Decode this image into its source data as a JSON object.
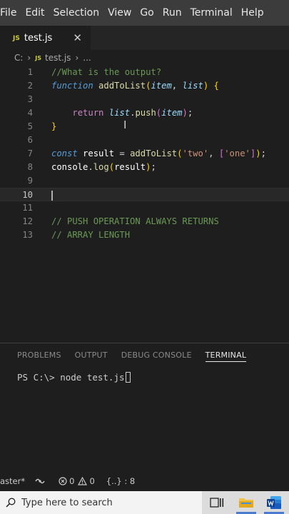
{
  "menubar": {
    "items": [
      "File",
      "Edit",
      "Selection",
      "View",
      "Go",
      "Run",
      "Terminal",
      "Help"
    ]
  },
  "tab": {
    "badge": "JS",
    "label": "test.js",
    "close": "✕"
  },
  "breadcrumb": {
    "root": "C:",
    "badge": "JS",
    "file": "test.js",
    "trail": "..."
  },
  "editor": {
    "line_numbers": [
      "1",
      "2",
      "3",
      "4",
      "5",
      "6",
      "7",
      "8",
      "9",
      "10",
      "11",
      "12",
      "13"
    ],
    "current_line": "10",
    "lines": [
      {
        "tokens": [
          {
            "t": "//What is the output?",
            "c": "c-comment"
          }
        ]
      },
      {
        "tokens": [
          {
            "t": "function",
            "c": "c-kw"
          },
          {
            "t": " ",
            "c": "c-punc"
          },
          {
            "t": "addToList",
            "c": "c-fn"
          },
          {
            "t": "(",
            "c": "c-bracket"
          },
          {
            "t": "item",
            "c": "c-param"
          },
          {
            "t": ", ",
            "c": "c-punc"
          },
          {
            "t": "list",
            "c": "c-param"
          },
          {
            "t": ")",
            "c": "c-bracket"
          },
          {
            "t": " ",
            "c": "c-punc"
          },
          {
            "t": "{",
            "c": "c-bracket"
          }
        ]
      },
      {
        "tokens": []
      },
      {
        "tokens": [
          {
            "t": "    ",
            "c": "c-punc"
          },
          {
            "t": "return",
            "c": "c-ret"
          },
          {
            "t": " ",
            "c": "c-punc"
          },
          {
            "t": "list",
            "c": "c-param"
          },
          {
            "t": ".",
            "c": "c-punc"
          },
          {
            "t": "push",
            "c": "c-fn"
          },
          {
            "t": "(",
            "c": "c-bracket2"
          },
          {
            "t": "item",
            "c": "c-param"
          },
          {
            "t": ")",
            "c": "c-bracket2"
          },
          {
            "t": ";",
            "c": "c-punc"
          }
        ]
      },
      {
        "tokens": [
          {
            "t": "}",
            "c": "c-bracket"
          }
        ]
      },
      {
        "tokens": []
      },
      {
        "tokens": [
          {
            "t": "const",
            "c": "c-kw"
          },
          {
            "t": " ",
            "c": "c-punc"
          },
          {
            "t": "result",
            "c": "c-var"
          },
          {
            "t": " = ",
            "c": "c-punc"
          },
          {
            "t": "addToList",
            "c": "c-fn"
          },
          {
            "t": "(",
            "c": "c-bracket"
          },
          {
            "t": "'two'",
            "c": "c-str"
          },
          {
            "t": ", ",
            "c": "c-punc"
          },
          {
            "t": "[",
            "c": "c-bracket2"
          },
          {
            "t": "'one'",
            "c": "c-str"
          },
          {
            "t": "]",
            "c": "c-bracket2"
          },
          {
            "t": ")",
            "c": "c-bracket"
          },
          {
            "t": ";",
            "c": "c-punc"
          }
        ]
      },
      {
        "tokens": [
          {
            "t": "console",
            "c": "c-var"
          },
          {
            "t": ".",
            "c": "c-punc"
          },
          {
            "t": "log",
            "c": "c-fn"
          },
          {
            "t": "(",
            "c": "c-bracket"
          },
          {
            "t": "result",
            "c": "c-var"
          },
          {
            "t": ")",
            "c": "c-bracket"
          },
          {
            "t": ";",
            "c": "c-punc"
          }
        ]
      },
      {
        "tokens": []
      },
      {
        "tokens": []
      },
      {
        "tokens": []
      },
      {
        "tokens": [
          {
            "t": "// PUSH OPERATION ALWAYS RETURNS",
            "c": "c-comment"
          }
        ]
      },
      {
        "tokens": [
          {
            "t": "// ARRAY LENGTH",
            "c": "c-comment"
          }
        ]
      }
    ]
  },
  "panel": {
    "tabs": [
      "PROBLEMS",
      "OUTPUT",
      "DEBUG CONSOLE",
      "TERMINAL"
    ],
    "active_tab": "TERMINAL",
    "terminal_prompt": "PS C:\\> node test.js"
  },
  "statusbar": {
    "branch": "aster*",
    "errors": "0",
    "warnings": "0",
    "lang_info": "{..} : 8"
  },
  "taskbar": {
    "search_placeholder": "Type here to search",
    "accent_color": "#4a7bd0"
  }
}
